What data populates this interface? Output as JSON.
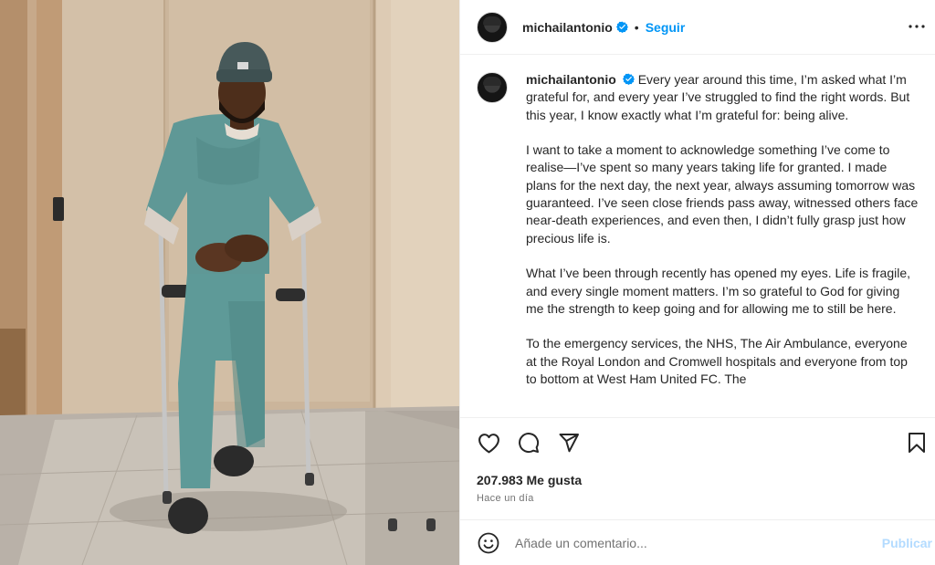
{
  "post": {
    "username": "michailantonio",
    "separator": "•",
    "follow_label": "Seguir",
    "caption": {
      "username": "michailantonio",
      "paragraphs": [
        "Every year around this time, I’m asked what I’m grateful for, and every year I’ve struggled to find the right words. But this year, I know exactly what I’m grateful for: being alive.",
        "I want to take a moment to acknowledge something I’ve come to realise—I’ve spent so many years taking life for granted. I made plans for the next day, the next year, always assuming tomorrow was guaranteed. I’ve seen close friends pass away, witnessed others face near-death experiences, and even then, I didn’t fully grasp just how precious life is.",
        "What I’ve been through recently has opened my eyes. Life is fragile, and every single moment matters. I’m so grateful to God for giving me the strength to keep going and for allowing me to still be here.",
        "To the emergency services, the NHS, The Air Ambulance, everyone at the Royal London and Cromwell hospitals and everyone from top to bottom at West Ham United FC. The"
      ]
    },
    "likes": "207.983 Me gusta",
    "time": "Hace un día",
    "comment_placeholder": "Añade un comentario...",
    "publish_label": "Publicar"
  },
  "icons": {
    "verified": "verified-badge-icon",
    "more": "more-options-icon",
    "like": "heart-icon",
    "comment": "comment-bubble-icon",
    "share": "paper-plane-icon",
    "save": "bookmark-icon",
    "emoji": "smiley-icon"
  },
  "colors": {
    "accent": "#0095f6",
    "publish_disabled": "#b3dbff",
    "text": "#262626",
    "muted": "#737373",
    "border": "#efefef"
  }
}
